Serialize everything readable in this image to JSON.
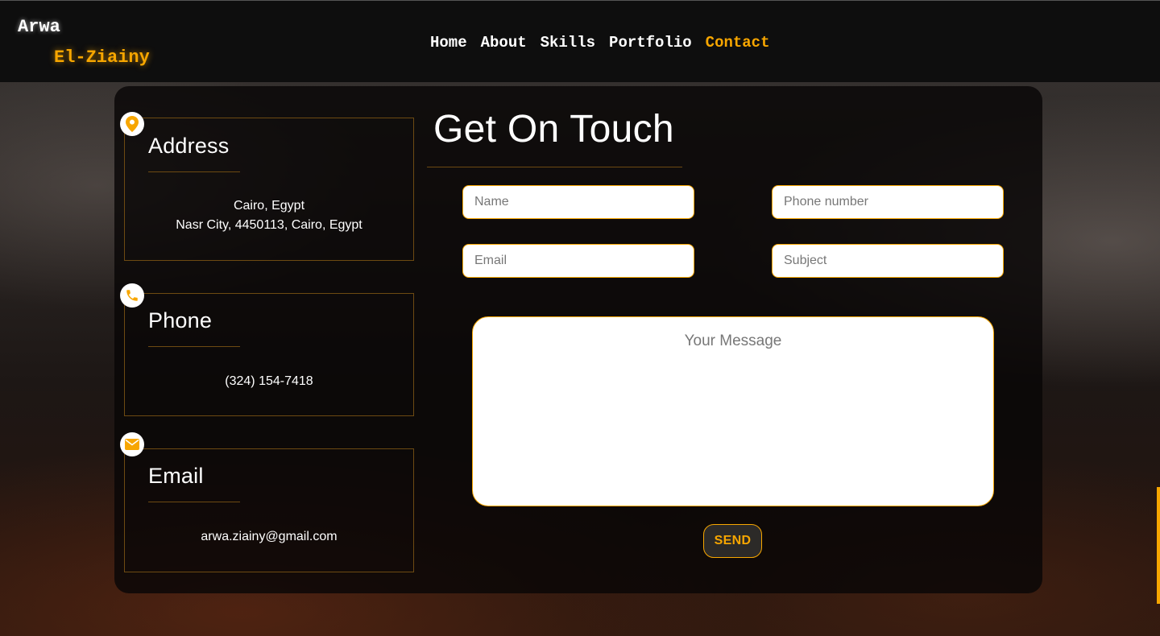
{
  "brand": {
    "first": "Arwa",
    "last": "El-Ziainy"
  },
  "nav": {
    "items": [
      {
        "label": "Home"
      },
      {
        "label": "About"
      },
      {
        "label": "Skills"
      },
      {
        "label": "Portfolio"
      },
      {
        "label": "Contact",
        "active": true
      }
    ]
  },
  "contact_info": {
    "address": {
      "title": "Address",
      "line1": "Cairo, Egypt",
      "line2": "Nasr City, 4450113, Cairo, Egypt",
      "icon": "map-pin-icon"
    },
    "phone": {
      "title": "Phone",
      "value": "(324) 154-7418",
      "icon": "phone-icon"
    },
    "email": {
      "title": "Email",
      "value": "arwa.ziainy@gmail.com",
      "icon": "envelope-icon"
    }
  },
  "form": {
    "title": "Get On Touch",
    "name_placeholder": "Name",
    "phone_placeholder": "Phone number",
    "email_placeholder": "Email",
    "subject_placeholder": "Subject",
    "message_placeholder": "Your Message",
    "send_label": "SEND"
  },
  "colors": {
    "accent": "#f7a600",
    "navbar": "#0e0e0e",
    "card": "#080606"
  }
}
